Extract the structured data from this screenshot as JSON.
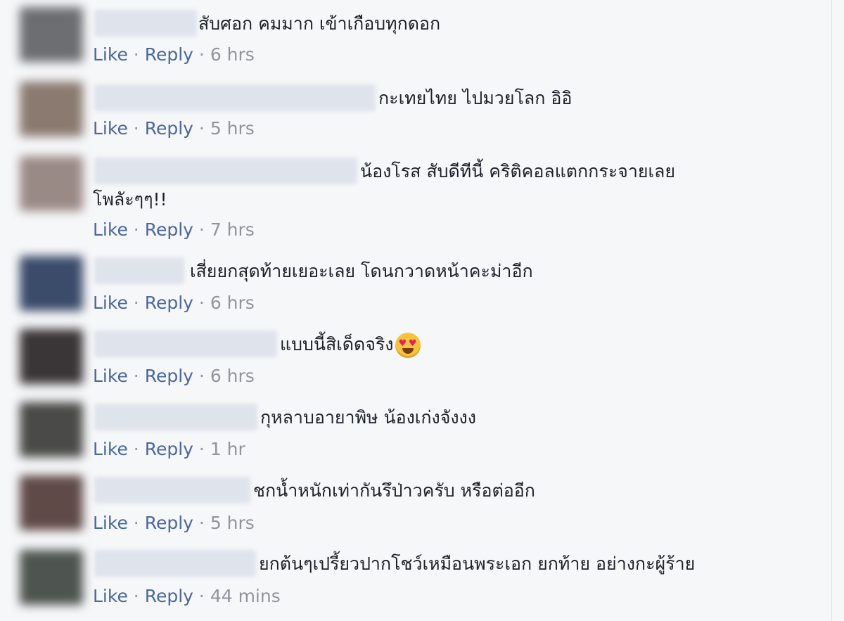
{
  "comments": [
    {
      "text": "สับศอก คมมาก เข้าเกือบทุกดอก",
      "text2": "",
      "like": "Like",
      "sep1": "·",
      "reply": "Reply",
      "sep2": "·",
      "time": "6 hrs",
      "avatar_color": "#6d6e72"
    },
    {
      "text": "กะเทยไทย ไปมวยโลก อิอิ",
      "text2": "",
      "like": "Like",
      "sep1": "·",
      "reply": "Reply",
      "sep2": "·",
      "time": "5 hrs",
      "avatar_color": "#8a7a70"
    },
    {
      "text": "น้องโรส สับดีทีนี้ คริติคอลแตกกระจายเลย",
      "text2": "โพลัะๆๆ!!",
      "like": "Like",
      "sep1": "·",
      "reply": "Reply",
      "sep2": "·",
      "time": "7 hrs",
      "avatar_color": "#9a8a86"
    },
    {
      "text": "เสี่ยยกสุดท้ายเยอะเลย โดนกวาดหน้าคะม่าอีก",
      "text2": "",
      "like": "Like",
      "sep1": "·",
      "reply": "Reply",
      "sep2": "·",
      "time": "6 hrs",
      "avatar_color": "#3b4b6a"
    },
    {
      "text": "แบบนี้สิเด็ดจริง",
      "text2": "",
      "emoji": "heart-eyes",
      "like": "Like",
      "sep1": "·",
      "reply": "Reply",
      "sep2": "·",
      "time": "6 hrs",
      "avatar_color": "#3a3536"
    },
    {
      "text": "กุหลาบอายาพิษ น้องเก่งจังงง",
      "text2": "",
      "like": "Like",
      "sep1": "·",
      "reply": "Reply",
      "sep2": "·",
      "time": "1 hr",
      "avatar_color": "#4a4a48"
    },
    {
      "text": "ชกน้ำหนักเท่ากันรึป่าวครับ หรือต่ออีก",
      "text2": "",
      "like": "Like",
      "sep1": "·",
      "reply": "Reply",
      "sep2": "·",
      "time": "5 hrs",
      "avatar_color": "#5f4a48"
    },
    {
      "text": "ยกต้นๆเปรี้ยวปากโชว์เหมือนพระเอก ยกท้าย อย่างกะผู้ร้าย",
      "text2": "",
      "like": "Like",
      "sep1": "·",
      "reply": "Reply",
      "sep2": "·",
      "time": "44 mins",
      "avatar_color": "#4e5450"
    }
  ]
}
